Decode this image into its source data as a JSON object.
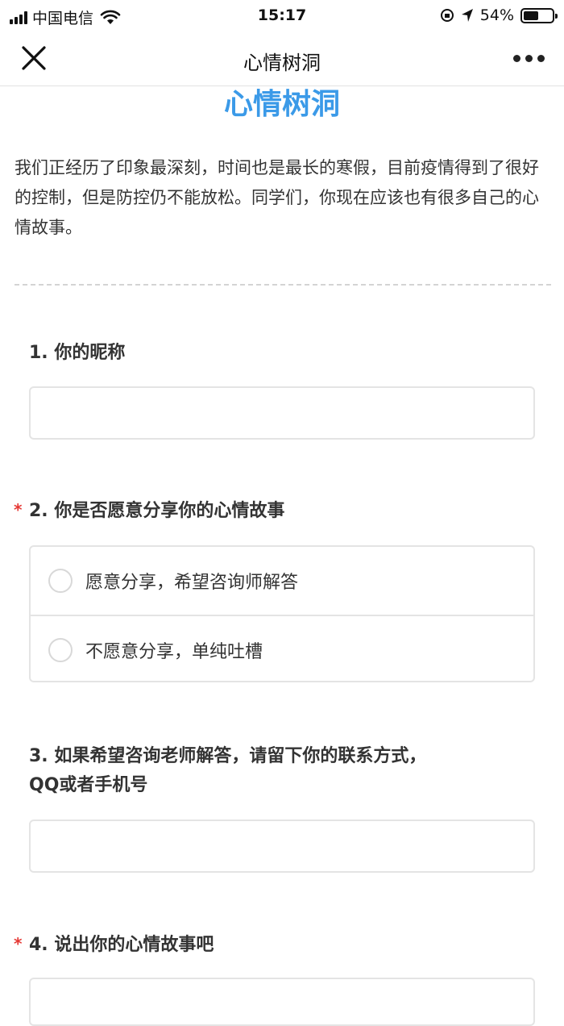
{
  "status_bar": {
    "carrier": "中国电信",
    "time": "15:17",
    "battery_text": "54%",
    "battery_level": 0.54
  },
  "nav": {
    "title": "心情树洞",
    "close_icon": "close-icon",
    "more_icon": "more-icon"
  },
  "page": {
    "heading": "心情树洞",
    "intro": "我们正经历了印象最深刻，时间也是最长的寒假，目前疫情得到了很好的控制，但是防控仍不能放松。同学们，你现在应该也有很多自己的心情故事。"
  },
  "questions": [
    {
      "label": "1. 你的昵称",
      "required": false,
      "value": ""
    },
    {
      "label": "2. 你是否愿意分享你的心情故事",
      "required": true,
      "options": [
        "愿意分享，希望咨询师解答",
        "不愿意分享，单纯吐槽"
      ]
    },
    {
      "label_line1": "3. 如果希望咨询老师解答，请留下你的联系方式，",
      "label_line2": "QQ或者手机号",
      "required": false,
      "value": ""
    },
    {
      "label": "4. 说出你的心情故事吧",
      "required": true,
      "value": ""
    }
  ],
  "required_mark": "*",
  "colors": {
    "accent": "#3b9ae8",
    "required": "#e53935"
  }
}
